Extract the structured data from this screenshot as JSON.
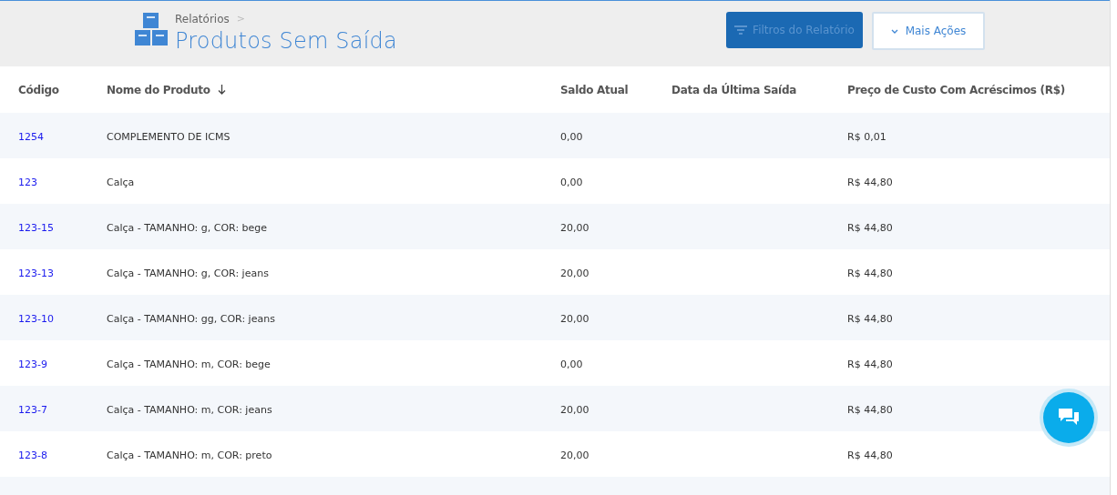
{
  "breadcrumb": "Relatórios",
  "breadcrumb_separator": ">",
  "title": "Produtos Sem Saída",
  "actions": [
    {
      "kind": "filter",
      "label": "Filtros do Relatório",
      "disabled": true
    },
    {
      "kind": "menu",
      "label": "Mais Ações",
      "disabled": false
    }
  ],
  "table": {
    "columns": [
      {
        "label": "Código",
        "sorted": false
      },
      {
        "label": "Nome do Produto",
        "sorted": true
      },
      {
        "label": "Saldo Atual",
        "sorted": false
      },
      {
        "label": "Data da Última Saída",
        "sorted": false
      },
      {
        "label": "Preço de Custo Com Acréscimos (R$)",
        "sorted": false
      }
    ],
    "rows": [
      {
        "code": "1254",
        "name": "COMPLEMENTO DE ICMS",
        "balance": "0,00",
        "price": "R$ 0,01"
      },
      {
        "code": "123",
        "name": "Calça",
        "balance": "0,00",
        "price": "R$ 44,80"
      },
      {
        "code": "123-15",
        "name": "Calça - TAMANHO: g, COR: bege",
        "balance": "20,00",
        "price": "R$ 44,80"
      },
      {
        "code": "123-13",
        "name": "Calça - TAMANHO: g, COR: jeans",
        "balance": "20,00",
        "price": "R$ 44,80"
      },
      {
        "code": "123-10",
        "name": "Calça - TAMANHO: gg, COR: jeans",
        "balance": "20,00",
        "price": "R$ 44,80"
      },
      {
        "code": "123-9",
        "name": "Calça - TAMANHO: m, COR: bege",
        "balance": "0,00",
        "price": "R$ 44,80"
      },
      {
        "code": "123-7",
        "name": "Calça - TAMANHO: m, COR: jeans",
        "balance": "20,00",
        "price": "R$ 44,80"
      },
      {
        "code": "123-8",
        "name": "Calça - TAMANHO: m, COR: preto",
        "balance": "20,00",
        "price": "R$ 44,80"
      }
    ]
  }
}
